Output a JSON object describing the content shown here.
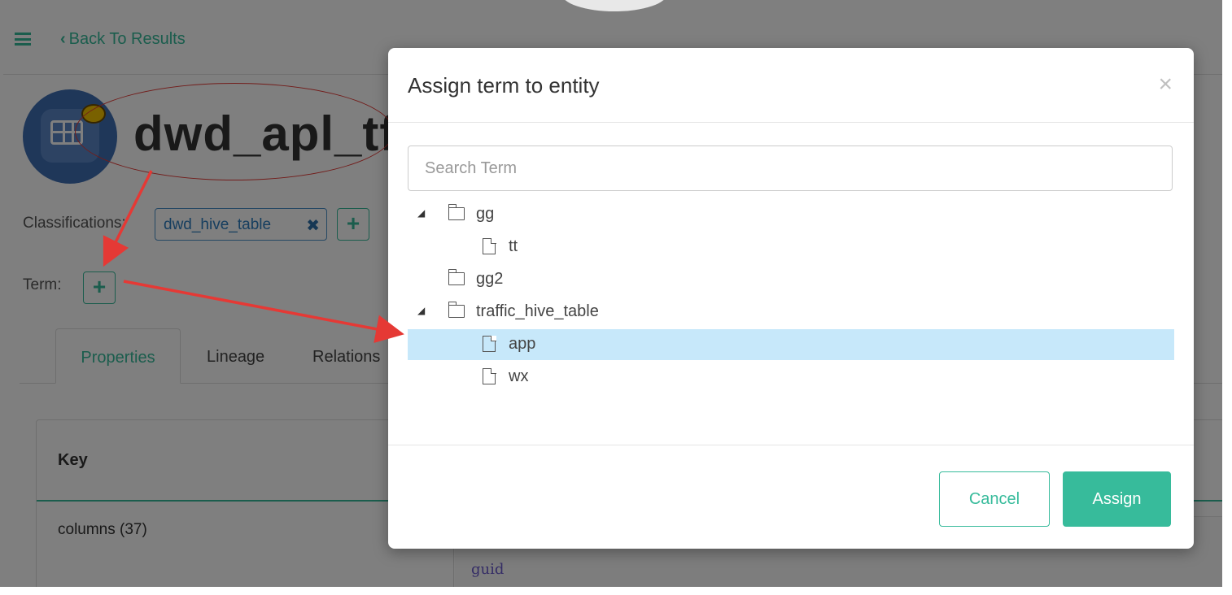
{
  "background": {
    "back_label": "Back To Results",
    "entity_title": "dwd_apl_tfc",
    "classifications_label": "Classifications:",
    "classification_tag": "dwd_hive_table",
    "classification_remove_icon": "times-icon",
    "term_label": "Term:",
    "add_icon": "plus-icon",
    "tabs": [
      {
        "label": "Properties",
        "active": true
      },
      {
        "label": "Lineage"
      },
      {
        "label": "Relations"
      }
    ],
    "table": {
      "key_header": "Key",
      "rows": [
        {
          "key": "columns (37)",
          "value": "guid"
        }
      ]
    }
  },
  "modal": {
    "title": "Assign term to entity",
    "close_icon": "close-icon",
    "search_placeholder": "Search Term",
    "tree": [
      {
        "label": "gg",
        "type": "folder",
        "expanded": true,
        "level": 0
      },
      {
        "label": "tt",
        "type": "file",
        "level": 1
      },
      {
        "label": "gg2",
        "type": "folder",
        "expanded": false,
        "level": 0
      },
      {
        "label": "traffic_hive_table",
        "type": "folder",
        "expanded": true,
        "level": 0
      },
      {
        "label": "app",
        "type": "file",
        "level": 1,
        "selected": true
      },
      {
        "label": "wx",
        "type": "file",
        "level": 1
      }
    ],
    "cancel_label": "Cancel",
    "assign_label": "Assign"
  },
  "colors": {
    "accent": "#37bb9b",
    "selected_row": "#c7e8fa",
    "annotation": "#e53935",
    "tag": "#2d7dbf"
  }
}
